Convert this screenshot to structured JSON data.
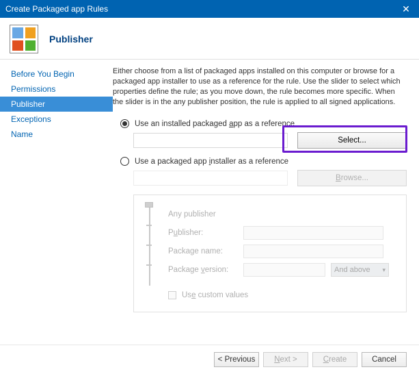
{
  "window": {
    "title": "Create Packaged app Rules"
  },
  "header": {
    "title": "Publisher"
  },
  "nav": {
    "items": [
      {
        "label": "Before You Begin"
      },
      {
        "label": "Permissions"
      },
      {
        "label": "Publisher"
      },
      {
        "label": "Exceptions"
      },
      {
        "label": "Name"
      }
    ],
    "activeIndex": 2
  },
  "intro": "Either choose from a list of packaged apps installed on this computer or browse for a packaged app installer to use as a reference for the rule. Use the slider to select which properties define the rule; as you move down, the rule becomes more specific. When the slider is in the any publisher position, the rule is applied to all signed applications.",
  "options": {
    "installed": {
      "label_pre": "Use an installed packaged ",
      "label_key": "a",
      "label_post": "pp as a reference",
      "select_btn": "Select...",
      "checked": true
    },
    "installer": {
      "label_pre": "Use a packaged app ",
      "label_key": "i",
      "label_post": "nstaller as a reference",
      "browse_btn": "Browse...",
      "checked": false
    }
  },
  "properties": {
    "any_publisher": "Any publisher",
    "publisher_pre": "P",
    "publisher_key": "u",
    "publisher_post": "blisher:",
    "package_name_pre": "Packa",
    "package_name_key": "g",
    "package_name_post": "e name:",
    "package_ver_pre": "Package ",
    "package_ver_key": "v",
    "package_ver_post": "ersion:",
    "combo": "And above",
    "use_custom_pre": "Us",
    "use_custom_key": "e",
    "use_custom_post": " custom values"
  },
  "footer": {
    "previous": "< Previous",
    "next_pre": "",
    "next_key": "N",
    "next_post": "ext >",
    "create_pre": "",
    "create_key": "C",
    "create_post": "reate",
    "cancel": "Cancel"
  }
}
